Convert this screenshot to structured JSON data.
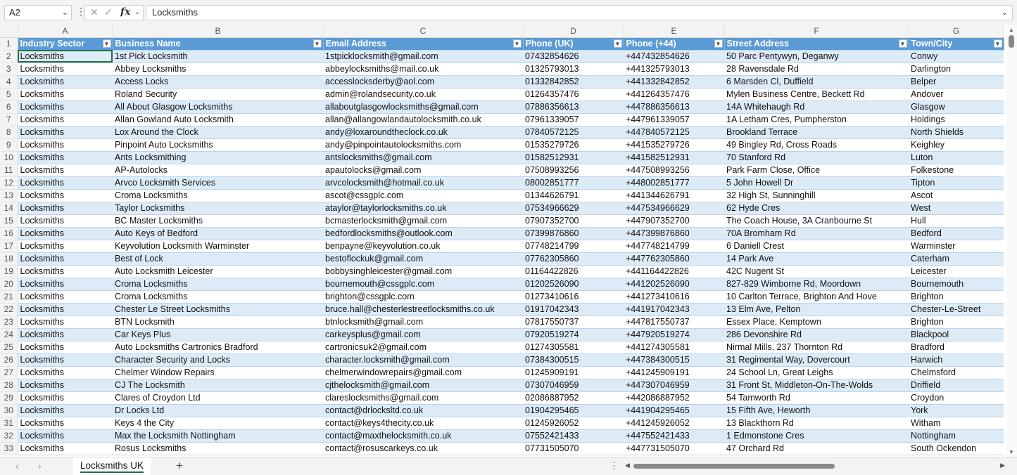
{
  "formula_bar": {
    "cell_ref": "A2",
    "fx_label": "fx",
    "value": "Locksmiths"
  },
  "columns": [
    "A",
    "B",
    "C",
    "D",
    "E",
    "F",
    "G"
  ],
  "headers": [
    "Industry Sector",
    "Business Name",
    "Email Address",
    "Phone (UK)",
    "Phone (+44)",
    "Street Address",
    "Town/City"
  ],
  "rows": [
    [
      "Locksmiths",
      "1st Pick Locksmith",
      "1stpicklocksmith@gmail.com",
      "07432854626",
      "+447432854626",
      "50 Parc Pentywyn, Deganwy",
      "Conwy"
    ],
    [
      "Locksmiths",
      "Abbey Locksmiths",
      "abbeylocksmiths@mail.co.uk",
      "01325793013",
      "+441325793013",
      "28 Ravensdale Rd",
      "Darlington"
    ],
    [
      "Locksmiths",
      "Access Locks",
      "accesslocksderby@aol.com",
      "01332842852",
      "+441332842852",
      "6 Marsden Cl, Duffield",
      "Belper"
    ],
    [
      "Locksmiths",
      "Roland Security",
      "admin@rolandsecurity.co.uk",
      "01264357476",
      "+441264357476",
      "Mylen Business Centre, Beckett Rd",
      "Andover"
    ],
    [
      "Locksmiths",
      "All About Glasgow Locksmiths",
      "allaboutglasgowlocksmiths@gmail.com",
      "07886356613",
      "+447886356613",
      "14A Whitehaugh Rd",
      "Glasgow"
    ],
    [
      "Locksmiths",
      "Allan Gowland Auto Locksmith",
      "allan@allangowlandautolocksmith.co.uk",
      "07961339057",
      "+447961339057",
      "1A Letham Cres, Pumpherston",
      "Holdings"
    ],
    [
      "Locksmiths",
      "Lox Around the Clock",
      "andy@loxaroundtheclock.co.uk",
      "07840572125",
      "+447840572125",
      "Brookland Terrace",
      "North Shields"
    ],
    [
      "Locksmiths",
      "Pinpoint Auto Locksmiths",
      "andy@pinpointautolocksmiths.com",
      "01535279726",
      "+441535279726",
      "49 Bingley Rd, Cross Roads",
      "Keighley"
    ],
    [
      "Locksmiths",
      "Ants Locksmithing",
      "antslocksmiths@gmail.com",
      "01582512931",
      "+441582512931",
      "70 Stanford Rd",
      "Luton"
    ],
    [
      "Locksmiths",
      "AP-Autolocks",
      "apautolocks@gmail.com",
      "07508993256",
      "+447508993256",
      "Park Farm Close, Office",
      "Folkestone"
    ],
    [
      "Locksmiths",
      "Arvco Locksmith Services",
      "arvcolocksmith@hotmail.co.uk",
      "08002851777",
      "+448002851777",
      "5 John Howell Dr",
      "Tipton"
    ],
    [
      "Locksmiths",
      "Croma Locksmiths",
      "ascot@cssgplc.com",
      "01344626791",
      "+441344626791",
      "32 High St, Sunninghill",
      "Ascot"
    ],
    [
      "Locksmiths",
      "Taylor Locksmiths",
      "ataylor@taylorlocksmiths.co.uk",
      "07534966629",
      "+447534966629",
      "62 Hyde Cres",
      "West"
    ],
    [
      "Locksmiths",
      "BC Master Locksmiths",
      "bcmasterlocksmith@gmail.com",
      "07907352700",
      "+447907352700",
      "The Coach House, 3A Cranbourne St",
      "Hull"
    ],
    [
      "Locksmiths",
      "Auto Keys of Bedford",
      "bedfordlocksmiths@outlook.com",
      "07399876860",
      "+447399876860",
      "70A Bromham Rd",
      "Bedford"
    ],
    [
      "Locksmiths",
      "Keyvolution Locksmith Warminster",
      "benpayne@keyvolution.co.uk",
      "07748214799",
      "+447748214799",
      "6 Daniell Crest",
      "Warminster"
    ],
    [
      "Locksmiths",
      "Best of Lock",
      "bestoflockuk@gmail.com",
      "07762305860",
      "+447762305860",
      "14 Park Ave",
      "Caterham"
    ],
    [
      "Locksmiths",
      "Auto Locksmith Leicester",
      "bobbysinghleicester@gmail.com",
      "01164422826",
      "+441164422826",
      "42C Nugent St",
      "Leicester"
    ],
    [
      "Locksmiths",
      "Croma Locksmiths",
      "bournemouth@cssgplc.com",
      "01202526090",
      "+441202526090",
      "827-829 Wimborne Rd, Moordown",
      "Bournemouth"
    ],
    [
      "Locksmiths",
      "Croma Locksmiths",
      "brighton@cssgplc.com",
      "01273410616",
      "+441273410616",
      "10 Carlton Terrace, Brighton And Hove",
      "Brighton"
    ],
    [
      "Locksmiths",
      "Chester Le Street Locksmiths",
      "bruce.hall@chesterlestreetlocksmiths.co.uk",
      "01917042343",
      "+441917042343",
      "13 Elm Ave, Pelton",
      "Chester-Le-Street"
    ],
    [
      "Locksmiths",
      "BTN Locksmith",
      "btnlocksmith@gmail.com",
      "07817550737",
      "+447817550737",
      "Essex Place, Kemptown",
      "Brighton"
    ],
    [
      "Locksmiths",
      "Car Keys Plus",
      "carkeysplus@gmail.com",
      "07920519274",
      "+447920519274",
      "286 Devonshire Rd",
      "Blackpool"
    ],
    [
      "Locksmiths",
      "Auto Locksmiths Cartronics Bradford",
      "cartronicsuk2@gmail.com",
      "01274305581",
      "+441274305581",
      "Nirmal Mills, 237 Thornton Rd",
      "Bradford"
    ],
    [
      "Locksmiths",
      "Character Security and Locks",
      "character.locksmith@gmail.com",
      "07384300515",
      "+447384300515",
      "31 Regimental Way, Dovercourt",
      "Harwich"
    ],
    [
      "Locksmiths",
      "Chelmer Window Repairs",
      "chelmerwindowrepairs@gmail.com",
      "01245909191",
      "+441245909191",
      "24 School Ln, Great Leighs",
      "Chelmsford"
    ],
    [
      "Locksmiths",
      "CJ The Locksmith",
      "cjthelocksmith@gmail.com",
      "07307046959",
      "+447307046959",
      "31 Front St, Middleton-On-The-Wolds",
      "Driffield"
    ],
    [
      "Locksmiths",
      "Clares of Croydon Ltd",
      "clareslocksmiths@gmail.com",
      "02086887952",
      "+442086887952",
      "54 Tamworth Rd",
      "Croydon"
    ],
    [
      "Locksmiths",
      "Dr Locks Ltd",
      "contact@drlocksltd.co.uk",
      "01904295465",
      "+441904295465",
      "15 Fifth Ave, Heworth",
      "York"
    ],
    [
      "Locksmiths",
      "Keys 4 the City",
      "contact@keys4thecity.co.uk",
      "01245926052",
      "+441245926052",
      "13 Blackthorn Rd",
      "Witham"
    ],
    [
      "Locksmiths",
      "Max the Locksmith Nottingham",
      "contact@maxthelocksmith.co.uk",
      "07552421433",
      "+447552421433",
      "1 Edmonstone Cres",
      "Nottingham"
    ],
    [
      "Locksmiths",
      "Rosus Locksmiths",
      "contact@rosuscarkeys.co.uk",
      "07731505070",
      "+447731505070",
      "47 Orchard Rd",
      "South Ockendon"
    ]
  ],
  "sheet_tab": "Locksmiths UK",
  "icons": {
    "cancel": "close-icon",
    "enter": "check-icon",
    "function": "fx-icon"
  }
}
